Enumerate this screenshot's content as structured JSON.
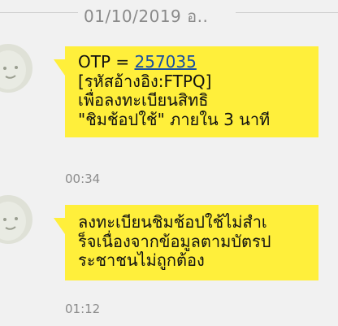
{
  "date_separator": "01/10/2019 อ..",
  "messages": [
    {
      "otp_prefix": "OTP = ",
      "otp_code": "257035",
      "lines": [
        "[รหัสอ้างอิง:FTPQ]",
        "เพื่อลงทะเบียนสิทธิ",
        "\"ชิมช้อปใช้\" ภายใน 3 นาที"
      ],
      "time": "00:34"
    },
    {
      "lines": [
        "ลงทะเบียนชิมช้อปใช้ไม่สำเ",
        "ร็จเนื่องจากข้อมูลตามบัตรป",
        "ระชาชนไม่ถูกต้อง"
      ],
      "time": "01:12"
    }
  ]
}
